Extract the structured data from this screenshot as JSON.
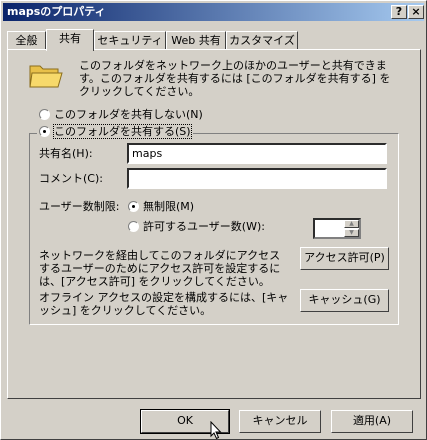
{
  "window": {
    "title": "mapsのプロパティ",
    "help_glyph": "?",
    "close_glyph": "×"
  },
  "tabs": [
    {
      "label": "全般"
    },
    {
      "label": "共有"
    },
    {
      "label": "セキュリティ"
    },
    {
      "label": "Web 共有"
    },
    {
      "label": "カスタマイズ"
    }
  ],
  "sharing": {
    "description": "このフォルダをネットワーク上のほかのユーザーと共有できます。このフォルダを共有するには [このフォルダを共有する] をクリックしてください。",
    "do_not_share_label": "このフォルダを共有しない(N)",
    "share_label": "このフォルダを共有する(S)",
    "share_name_label": "共有名(H):",
    "share_name_value": "maps",
    "comment_label": "コメント(C):",
    "comment_value": "",
    "user_limit_label": "ユーザー数制限:",
    "unlimited_label": "無制限(M)",
    "allow_users_label": "許可するユーザー数(W):",
    "allow_users_value": "",
    "permissions_text": "ネットワークを経由してこのフォルダにアクセスするユーザーのためにアクセス許可を設定するには、[アクセス許可] をクリックしてください。",
    "permissions_button": "アクセス許可(P)",
    "offline_text": "オフライン アクセスの設定を構成するには、[キャッシュ] をクリックしてください。",
    "cache_button": "キャッシュ(G)"
  },
  "footer": {
    "ok": "OK",
    "cancel": "キャンセル",
    "apply": "適用(A)"
  },
  "icons": {
    "folder": "shared-folder-icon",
    "cursor": "mouse-pointer-icon"
  }
}
